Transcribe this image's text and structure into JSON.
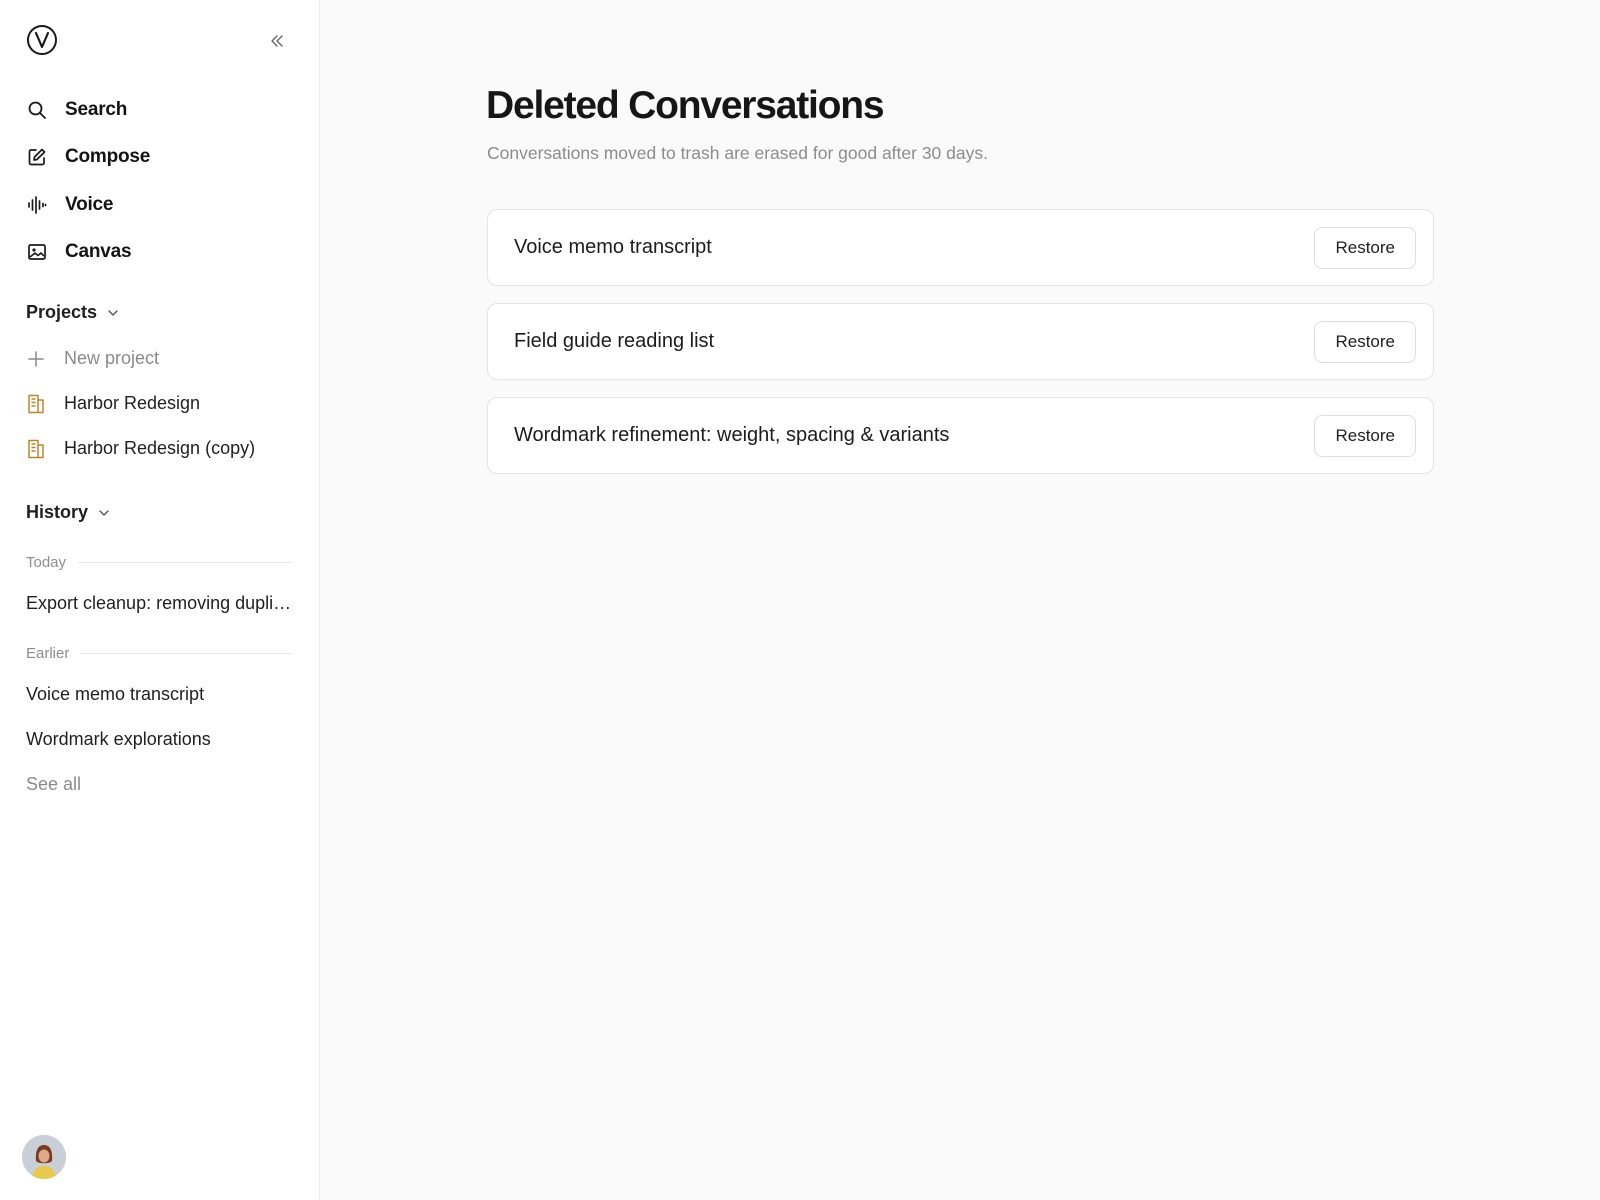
{
  "sidebar": {
    "nav": [
      {
        "label": "Search",
        "icon": "search-icon"
      },
      {
        "label": "Compose",
        "icon": "compose-icon"
      },
      {
        "label": "Voice",
        "icon": "waveform-icon"
      },
      {
        "label": "Canvas",
        "icon": "image-icon"
      }
    ],
    "projects": {
      "header": "Projects",
      "new_label": "New project",
      "items": [
        {
          "label": "Harbor Redesign",
          "icon": "project-document-icon"
        },
        {
          "label": "Harbor Redesign (copy)",
          "icon": "project-document-icon"
        }
      ]
    },
    "history": {
      "header": "History",
      "today_label": "Today",
      "today_items": [
        "Export cleanup: removing duplicate entries"
      ],
      "earlier_label": "Earlier",
      "earlier_items": [
        "Voice memo transcript",
        "Wordmark explorations"
      ],
      "see_all": "See all"
    }
  },
  "main": {
    "title": "Deleted Conversations",
    "subtitle": "Conversations moved to trash are erased for good after 30 days.",
    "conversations": [
      {
        "title": "Voice memo transcript",
        "action": "Restore"
      },
      {
        "title": "Field guide reading list",
        "action": "Restore"
      },
      {
        "title": "Wordmark refinement: weight, spacing & variants",
        "action": "Restore"
      }
    ]
  },
  "colors": {
    "project_icon": "#b8862b",
    "background": "#fafafa",
    "sidebar": "#ffffff"
  }
}
